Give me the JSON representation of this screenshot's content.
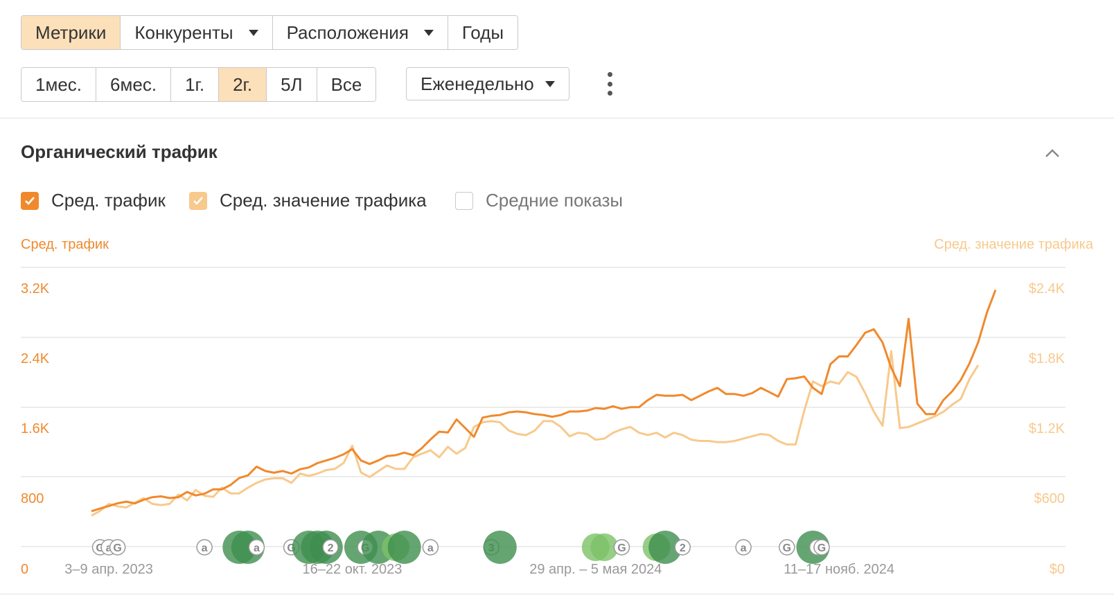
{
  "tabs": {
    "metrics": "Метрики",
    "competitors": "Конкуренты",
    "locations": "Расположения",
    "years": "Годы"
  },
  "periods": [
    "1мес.",
    "6мес.",
    "1г.",
    "2г.",
    "5Л",
    "Все"
  ],
  "active_period": "2г.",
  "frequency": "Еженедельно",
  "panel": {
    "title": "Органический трафик",
    "legend": {
      "traffic": "Сред. трафик",
      "value": "Сред. значение трафика",
      "impressions": "Средние показы"
    }
  },
  "icons": {
    "caret": "caret-down-icon",
    "more": "kebab-menu-icon",
    "collapse": "chevron-up-icon",
    "check": "check-icon"
  },
  "colors": {
    "accent": "#f0892c",
    "accent_light": "#f8c98c",
    "active_tab": "#fce0b9",
    "annotation_green": "#3f8f4f",
    "annotation_light_green": "#7cc266"
  },
  "chart_data": {
    "type": "line",
    "left_axis_title": "Сред. трафик",
    "right_axis_title": "Сред. значение трафика",
    "left_ticks": [
      "0",
      "800",
      "1.6K",
      "2.4K",
      "3.2K"
    ],
    "right_ticks": [
      "$0",
      "$600",
      "$1.2K",
      "$1.8K",
      "$2.4K"
    ],
    "ylim_left": [
      0,
      3200
    ],
    "ylim_right": [
      0,
      2400
    ],
    "x_tick_labels": [
      "3–9 апр. 2023",
      "16–22 окт. 2023",
      "29 апр. – 5 мая 2024",
      "11–17 нояб. 2024"
    ],
    "x_tick_weeks": [
      2,
      30,
      58,
      86
    ],
    "series": [
      {
        "name": "Сред. трафик",
        "axis": "left",
        "color": "#f0892c",
        "values": [
          650,
          680,
          710,
          740,
          760,
          740,
          780,
          810,
          820,
          800,
          810,
          870,
          830,
          850,
          900,
          900,
          950,
          1030,
          1060,
          1160,
          1110,
          1090,
          1110,
          1080,
          1130,
          1150,
          1200,
          1230,
          1260,
          1300,
          1360,
          1230,
          1190,
          1230,
          1280,
          1290,
          1320,
          1290,
          1370,
          1470,
          1560,
          1550,
          1700,
          1600,
          1500,
          1720,
          1740,
          1750,
          1780,
          1790,
          1780,
          1760,
          1750,
          1730,
          1750,
          1790,
          1790,
          1800,
          1830,
          1820,
          1850,
          1820,
          1840,
          1840,
          1920,
          1980,
          1970,
          1970,
          1980,
          1920,
          1970,
          2020,
          2060,
          1990,
          1990,
          1970,
          2000,
          2060,
          2010,
          1960,
          2160,
          2170,
          2190,
          2060,
          1990,
          2330,
          2420,
          2420,
          2550,
          2690,
          2730,
          2580,
          2290,
          2080,
          2850,
          1880,
          1760,
          1760,
          1920,
          2020,
          2150,
          2340,
          2580,
          2920,
          3180
        ]
      },
      {
        "name": "Сред. значение трафика",
        "axis": "right",
        "color": "#f8c98c",
        "values": [
          450,
          490,
          550,
          530,
          520,
          560,
          600,
          550,
          540,
          550,
          630,
          580,
          670,
          620,
          610,
          690,
          640,
          640,
          690,
          730,
          760,
          770,
          770,
          730,
          810,
          790,
          810,
          840,
          850,
          900,
          1050,
          820,
          780,
          830,
          880,
          850,
          850,
          950,
          980,
          1010,
          950,
          1040,
          980,
          1030,
          1210,
          1250,
          1260,
          1250,
          1180,
          1150,
          1140,
          1180,
          1260,
          1260,
          1210,
          1130,
          1160,
          1150,
          1100,
          1110,
          1160,
          1190,
          1210,
          1160,
          1140,
          1160,
          1120,
          1160,
          1140,
          1100,
          1090,
          1090,
          1080,
          1080,
          1090,
          1110,
          1130,
          1150,
          1140,
          1090,
          1060,
          1060,
          1350,
          1600,
          1560,
          1600,
          1580,
          1680,
          1640,
          1500,
          1340,
          1220,
          1860,
          1200,
          1210,
          1240,
          1270,
          1300,
          1340,
          1400,
          1450,
          1620,
          1740
        ]
      }
    ],
    "annotations": {
      "labels": [
        "G",
        "a",
        "2",
        "3"
      ],
      "markers": [
        {
          "week": 1,
          "kind": "label",
          "text": "G"
        },
        {
          "week": 2,
          "kind": "label",
          "text": "a"
        },
        {
          "week": 3,
          "kind": "label",
          "text": "G"
        },
        {
          "week": 13,
          "kind": "label",
          "text": "a"
        },
        {
          "week": 17,
          "kind": "dark"
        },
        {
          "week": 18,
          "kind": "dark"
        },
        {
          "week": 19,
          "kind": "label",
          "text": "a"
        },
        {
          "week": 23,
          "kind": "label",
          "text": "G"
        },
        {
          "week": 25,
          "kind": "dark"
        },
        {
          "week": 26,
          "kind": "dark"
        },
        {
          "week": 27,
          "kind": "dark"
        },
        {
          "week": 27.5,
          "kind": "label",
          "text": "2"
        },
        {
          "week": 31,
          "kind": "dark"
        },
        {
          "week": 31.5,
          "kind": "label",
          "text": "G"
        },
        {
          "week": 33,
          "kind": "dark"
        },
        {
          "week": 35,
          "kind": "light"
        },
        {
          "week": 36,
          "kind": "dark"
        },
        {
          "week": 39,
          "kind": "label",
          "text": "a"
        },
        {
          "week": 46,
          "kind": "label",
          "text": "3"
        },
        {
          "week": 47,
          "kind": "dark"
        },
        {
          "week": 58,
          "kind": "light"
        },
        {
          "week": 59,
          "kind": "light"
        },
        {
          "week": 61,
          "kind": "label",
          "text": "G"
        },
        {
          "week": 65,
          "kind": "light"
        },
        {
          "week": 66,
          "kind": "dark"
        },
        {
          "week": 68,
          "kind": "label",
          "text": "2"
        },
        {
          "week": 75,
          "kind": "label",
          "text": "a"
        },
        {
          "week": 80,
          "kind": "label",
          "text": "G"
        },
        {
          "week": 83,
          "kind": "dark"
        },
        {
          "week": 83.5,
          "kind": "label",
          "text": "G"
        },
        {
          "week": 84,
          "kind": "label",
          "text": "G"
        }
      ]
    },
    "grid": true,
    "legend": "top-left"
  }
}
